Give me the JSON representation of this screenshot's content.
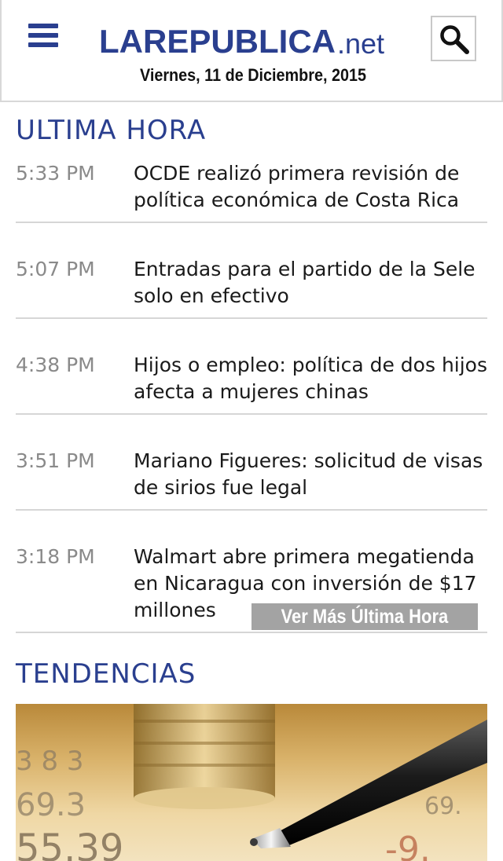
{
  "header": {
    "logo_main": "LAREPUBLICA",
    "logo_net": ".net",
    "date": "Viernes, 11 de Diciembre, 2015",
    "menu_icon": "hamburger-menu-icon",
    "search_icon": "search-icon"
  },
  "ultima_hora": {
    "title": "ULTIMA HORA",
    "items": [
      {
        "time": "5:33 PM",
        "headline": "OCDE realizó primera revisión de política económica de Costa Rica"
      },
      {
        "time": "5:07 PM",
        "headline": "Entradas para el partido de la Sele solo en efectivo"
      },
      {
        "time": "4:38 PM",
        "headline": "Hijos o empleo: política de dos hijos afecta a mujeres chinas"
      },
      {
        "time": "3:51 PM",
        "headline": "Mariano Figueres: solicitud de visas de sirios fue legal"
      },
      {
        "time": "3:18 PM",
        "headline": "Walmart abre primera megatienda en Nicaragua con inversión de $17 millones"
      }
    ],
    "more_label": "Ver Más Última Hora"
  },
  "tendencias": {
    "title": "TENDENCIAS",
    "image_numbers": [
      "55.39",
      "69.3",
      "-9."
    ]
  },
  "colors": {
    "brand_blue": "#2a3f8f",
    "time_gray": "#8a8a8a",
    "button_gray": "#a3a3a3"
  }
}
